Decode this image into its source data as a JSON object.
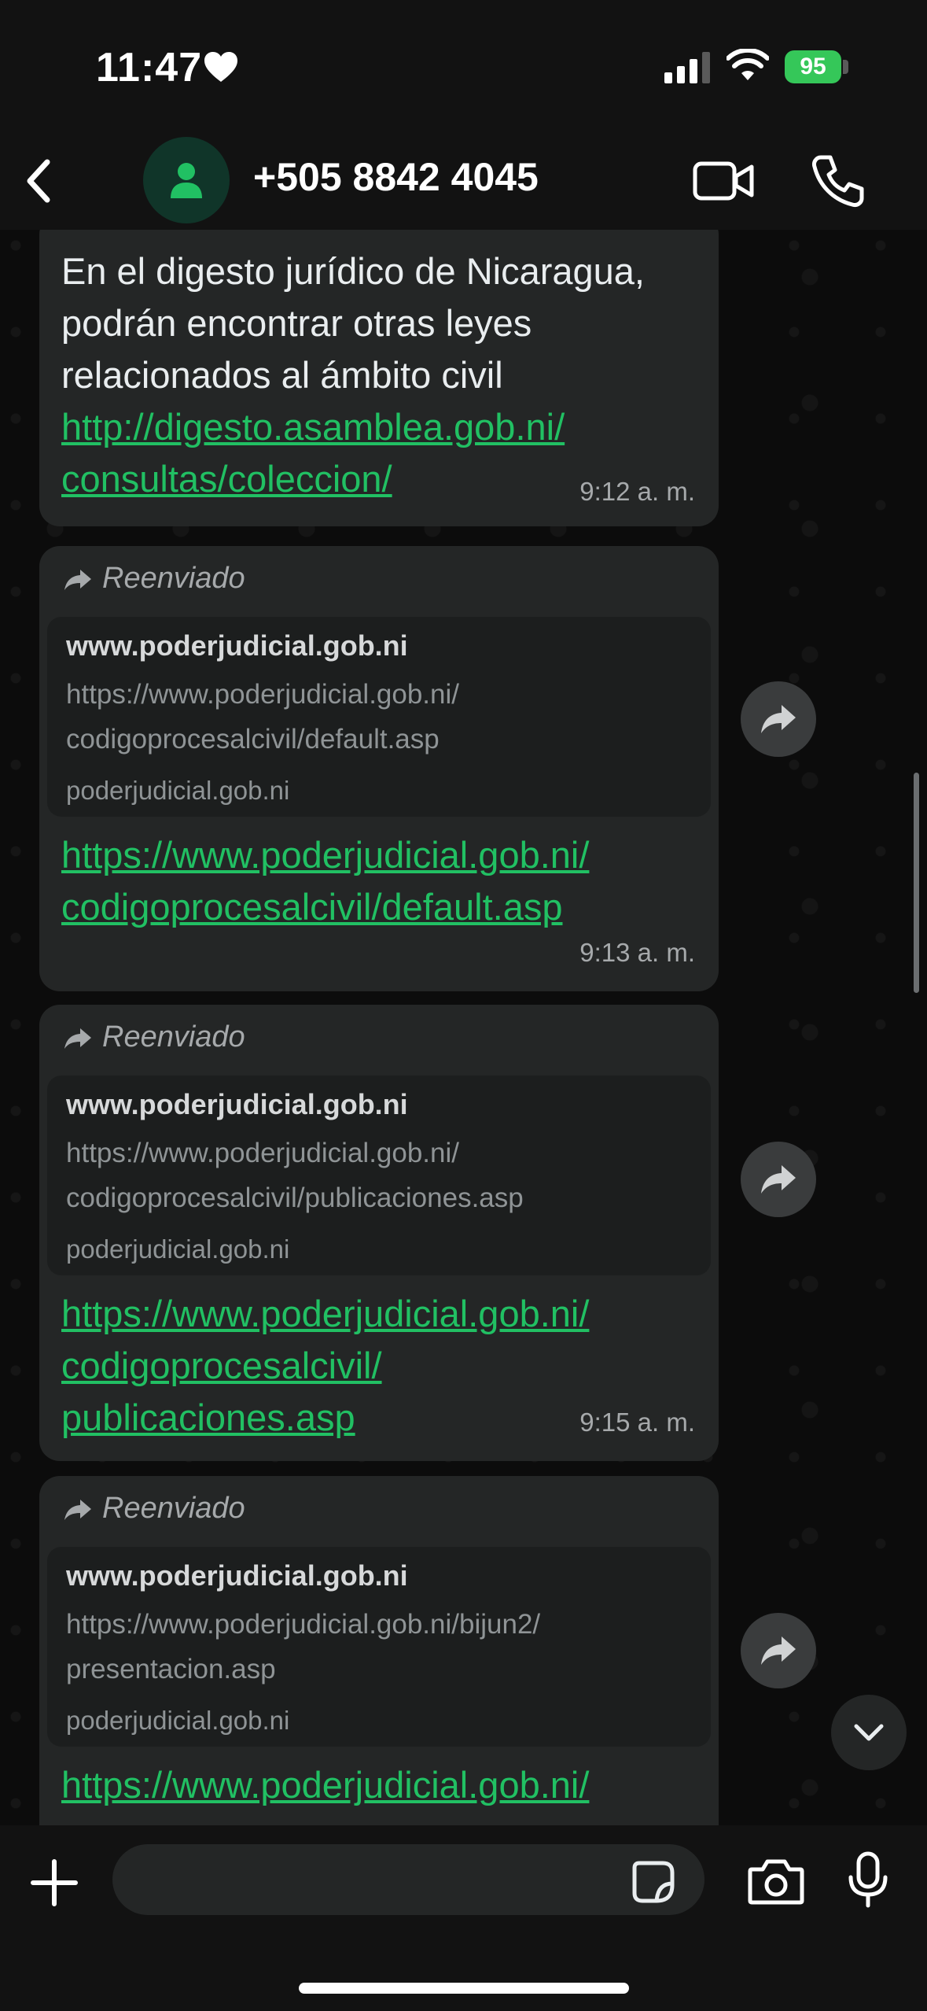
{
  "status": {
    "time": "11:47",
    "battery": "95"
  },
  "header": {
    "contact": "+505 8842 4045"
  },
  "messages": [
    {
      "text": "En el digesto jurídico de Nicaragua, podrán encontrar otras leyes relacionados al ámbito civil",
      "link_line1": "http://digesto.asamblea.gob.ni/",
      "link_line2": "consultas/coleccion/",
      "time": "9:12 a. m."
    },
    {
      "forwarded": "Reenviado",
      "preview_title": "www.poderjudicial.gob.ni",
      "preview_url_line1": "https://www.poderjudicial.gob.ni/",
      "preview_url_line2": "codigoprocesalcivil/default.asp",
      "preview_domain": "poderjudicial.gob.ni",
      "link_line1": "https://www.poderjudicial.gob.ni/",
      "link_line2": "codigoprocesalcivil/default.asp",
      "time": "9:13 a. m."
    },
    {
      "forwarded": "Reenviado",
      "preview_title": "www.poderjudicial.gob.ni",
      "preview_url_line1": "https://www.poderjudicial.gob.ni/",
      "preview_url_line2": "codigoprocesalcivil/publicaciones.asp",
      "preview_domain": "poderjudicial.gob.ni",
      "link_line1": "https://www.poderjudicial.gob.ni/",
      "link_line2": "codigoprocesalcivil/",
      "link_line3": "publicaciones.asp",
      "time": "9:15 a. m."
    },
    {
      "forwarded": "Reenviado",
      "preview_title": "www.poderjudicial.gob.ni",
      "preview_url_line1": "https://www.poderjudicial.gob.ni/bijun2/",
      "preview_url_line2": "presentacion.asp",
      "preview_domain": "poderjudicial.gob.ni",
      "link_line1": "https://www.poderjudicial.gob.ni/"
    }
  ],
  "colors": {
    "link": "#21c063",
    "bubble": "#242626",
    "accent_green": "#35c759"
  }
}
